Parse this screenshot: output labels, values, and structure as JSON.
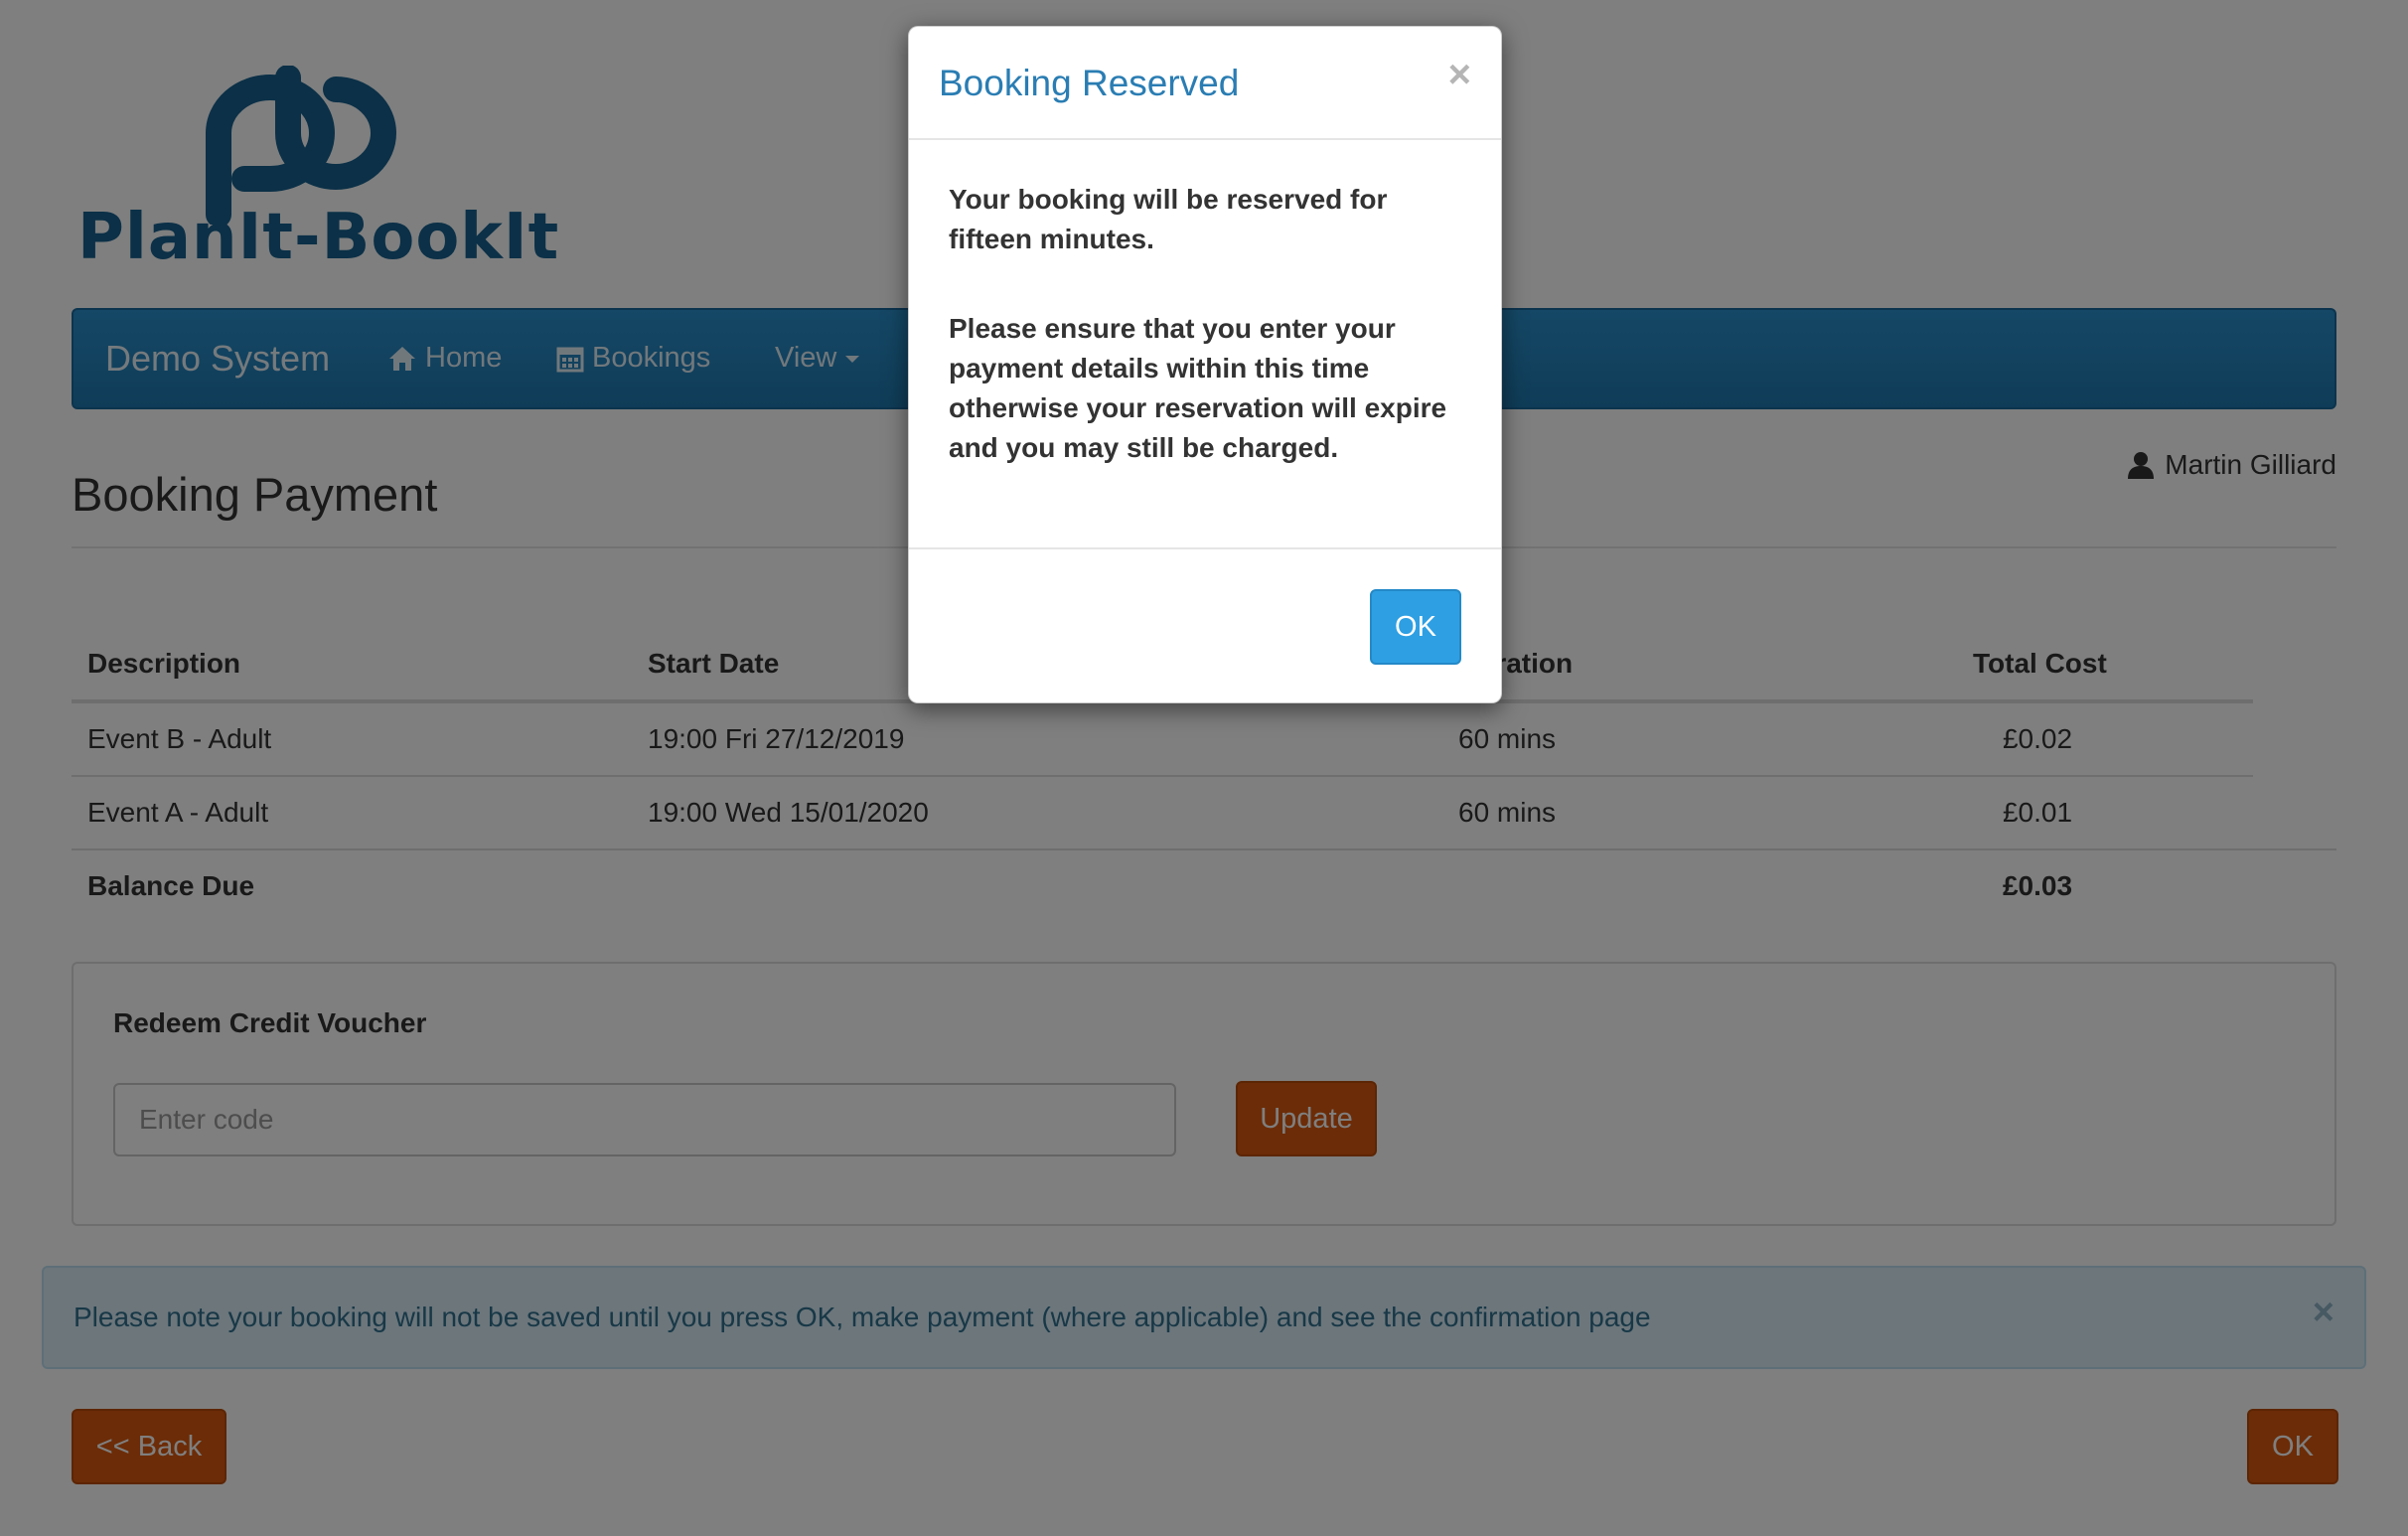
{
  "logo": {
    "text": "PlanIt-BookIt"
  },
  "navbar": {
    "brand": "Demo System",
    "items": [
      {
        "label": "Home",
        "icon": "home-icon"
      },
      {
        "label": "Bookings",
        "icon": "calendar-icon"
      },
      {
        "label": "View",
        "icon": "caret-down-icon"
      }
    ]
  },
  "page": {
    "title": "Booking Payment",
    "user": "Martin Gilliard"
  },
  "table": {
    "headers": [
      "Description",
      "Start Date",
      "Duration",
      "Total Cost"
    ],
    "rows": [
      {
        "description": "Event B - Adult",
        "start": "19:00 Fri 27/12/2019",
        "duration": "60 mins",
        "cost": "£0.02"
      },
      {
        "description": "Event A - Adult",
        "start": "19:00 Wed 15/01/2020",
        "duration": "60 mins",
        "cost": "£0.01"
      }
    ],
    "balance": {
      "label": "Balance Due",
      "value": "£0.03"
    }
  },
  "voucher": {
    "title": "Redeem Credit Voucher",
    "placeholder": "Enter code",
    "value": "",
    "button": "Update"
  },
  "alert": {
    "text": "Please note your booking will not be saved until you press OK, make payment (where applicable) and see the confirmation page",
    "close": "×"
  },
  "footer": {
    "back": "<< Back",
    "ok": "OK"
  },
  "modal": {
    "title": "Booking Reserved",
    "close": "×",
    "p1": "Your booking will be reserved for fifteen minutes.",
    "p2": "Please ensure that you enter your payment details within this time otherwise your reservation will expire and you may still be charged.",
    "ok": "OK"
  },
  "colors": {
    "navbar": "#1f79b0",
    "orange_button": "#d9590e",
    "modal_ok": "#2e9fe3",
    "alert_bg": "#d9edf7"
  }
}
